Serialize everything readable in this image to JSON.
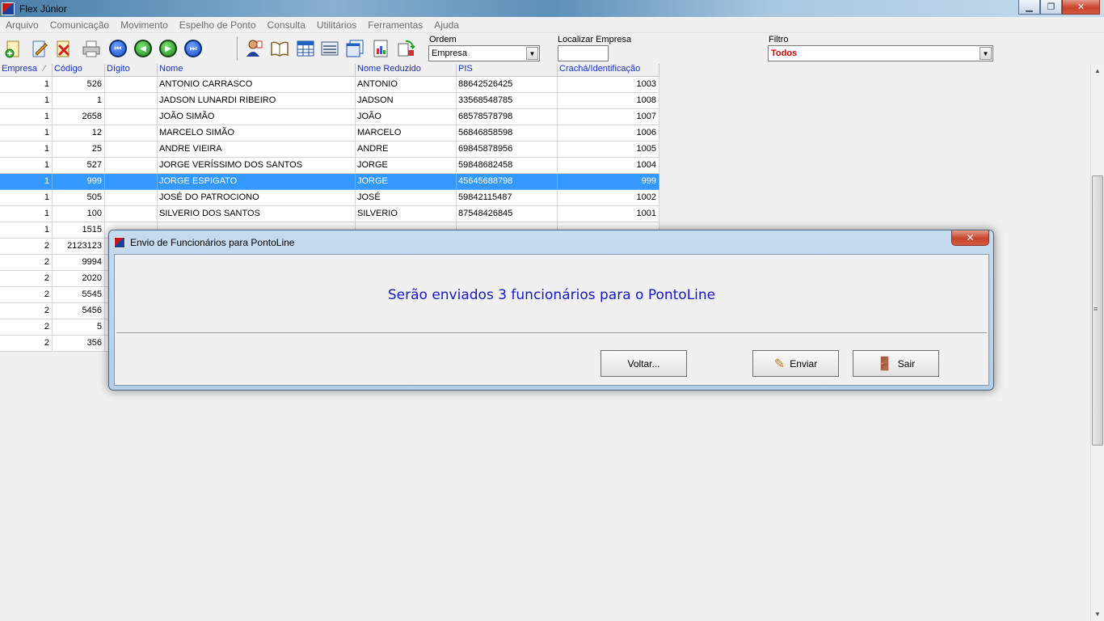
{
  "window": {
    "title": "Flex Júnior",
    "min_glyph": "▁",
    "max_glyph": "❐",
    "close_glyph": "✕"
  },
  "menu": [
    "Arquivo",
    "Comunicação",
    "Movimento",
    "Espelho de Ponto",
    "Consulta",
    "Utilitários",
    "Ferramentas",
    "Ajuda"
  ],
  "toolbar": {
    "ordem_label": "Ordem",
    "ordem_value": "Empresa",
    "localizar_label": "Localizar Empresa",
    "localizar_value": "",
    "filtro_label": "Filtro",
    "filtro_value": "Todos",
    "filtro_color": "#d00000",
    "nav_glyphs": {
      "first": "⏮",
      "prev": "◀",
      "next": "▶",
      "last": "⏭"
    }
  },
  "grid": {
    "columns": [
      "Empresa",
      "Código",
      "Dígito",
      "Nome",
      "Nome Reduzido",
      "PIS",
      "Crachá/Identificação"
    ],
    "sort_indicator": "⁄",
    "rows": [
      [
        "1",
        "526",
        "",
        "ANTONIO CARRASCO",
        "ANTONIO",
        "88642526425",
        "1003"
      ],
      [
        "1",
        "1",
        "",
        "JADSON LUNARDI RIBEIRO",
        "JADSON",
        "33568548785",
        "1008"
      ],
      [
        "1",
        "2658",
        "",
        "JOÃO SIMÃO",
        "JOÃO",
        "68578578798",
        "1007"
      ],
      [
        "1",
        "12",
        "",
        "MARCELO SIMÃO",
        "MARCELO",
        "56846858598",
        "1006"
      ],
      [
        "1",
        "25",
        "",
        "ANDRE VIEIRA",
        "ANDRE",
        "69845878956",
        "1005"
      ],
      [
        "1",
        "527",
        "",
        "JORGE VERÍSSIMO DOS SANTOS",
        "JORGE",
        "59848682458",
        "1004"
      ],
      [
        "1",
        "999",
        "",
        "JORGE ESPIGATO",
        "JORGE",
        "45645688798",
        "999"
      ],
      [
        "1",
        "505",
        "",
        "JOSÉ DO PATROCIONO",
        "JOSÉ",
        "59842115487",
        "1002"
      ],
      [
        "1",
        "100",
        "",
        "SILVERIO DOS SANTOS",
        "SILVERIO",
        "87548426845",
        "1001"
      ],
      [
        "1",
        "1515",
        "",
        "",
        "",
        "",
        ""
      ],
      [
        "2",
        "2123123",
        "",
        "",
        "",
        "",
        ""
      ],
      [
        "2",
        "9994",
        "",
        "",
        "",
        "",
        ""
      ],
      [
        "2",
        "2020",
        "",
        "",
        "",
        "",
        ""
      ],
      [
        "2",
        "5545",
        "",
        "",
        "",
        "",
        ""
      ],
      [
        "2",
        "5456",
        "",
        "",
        "",
        "",
        ""
      ],
      [
        "2",
        "5",
        "",
        "",
        "",
        "",
        ""
      ],
      [
        "2",
        "356",
        "",
        "",
        "",
        "",
        ""
      ]
    ],
    "selected_row": 6
  },
  "dialog": {
    "title": "Envio de Funcionários para PontoLine",
    "close_glyph": "✕",
    "message": "Serão enviados 3 funcionários para o PontoLine",
    "voltar_label": "Voltar...",
    "enviar_label": "Enviar",
    "sair_label": "Sair",
    "enviar_icon": "✎",
    "sair_icon": "🚪"
  }
}
